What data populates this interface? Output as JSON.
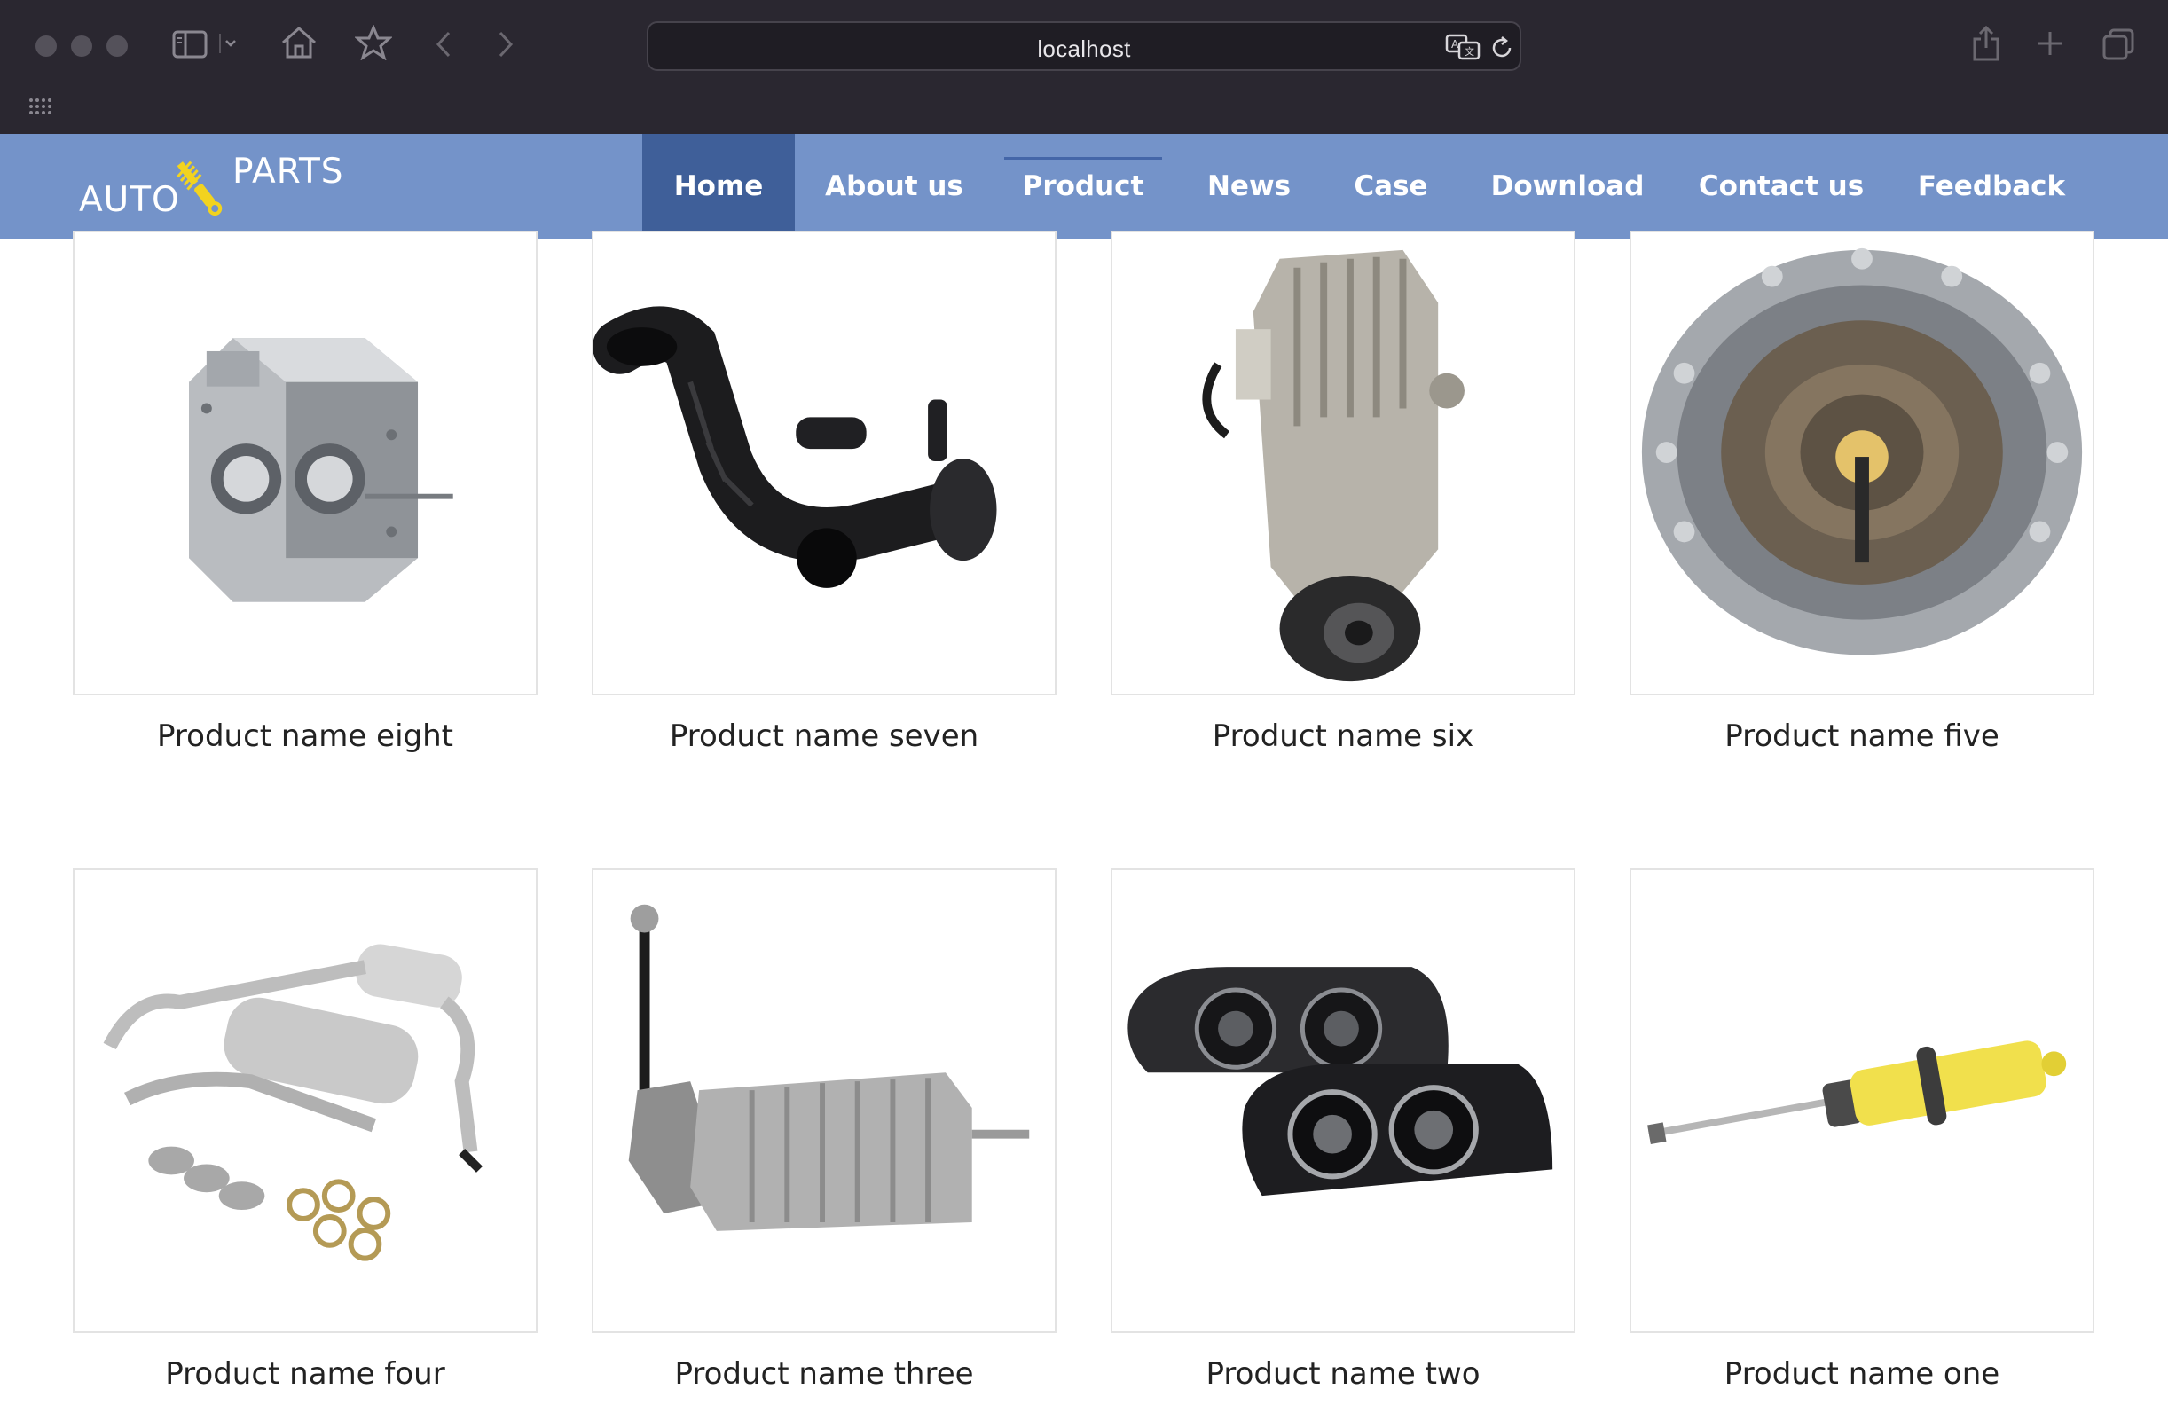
{
  "browser": {
    "url": "localhost",
    "icons": [
      "traffic-lights",
      "sidebar-icon",
      "chevron-down-icon",
      "home-icon",
      "star-icon",
      "back-icon",
      "forward-icon",
      "translate-icon",
      "reload-icon",
      "share-icon",
      "new-tab-icon",
      "tab-overview-icon",
      "grid-icon"
    ]
  },
  "site": {
    "logo": {
      "auto": "AUTO",
      "parts": "PARTS"
    },
    "nav": [
      {
        "label": "Home"
      },
      {
        "label": "About us"
      },
      {
        "label": "Product"
      },
      {
        "label": "News"
      },
      {
        "label": "Case"
      },
      {
        "label": "Download"
      },
      {
        "label": "Contact us"
      },
      {
        "label": "Feedback"
      }
    ],
    "colors": {
      "header": "#7493c9",
      "nav_active": "#3f5f99",
      "text": "#222222",
      "card_border": "#e3e3e3"
    }
  },
  "products": [
    {
      "name": "Product name eight",
      "image": "engine-block"
    },
    {
      "name": "Product name seven",
      "image": "intake-hose"
    },
    {
      "name": "Product name six",
      "image": "supercharger"
    },
    {
      "name": "Product name five",
      "image": "transmission-housing"
    },
    {
      "name": "Product name four",
      "image": "exhaust-kit"
    },
    {
      "name": "Product name three",
      "image": "gearbox"
    },
    {
      "name": "Product name two",
      "image": "headlights"
    },
    {
      "name": "Product name one",
      "image": "shock-absorber"
    }
  ]
}
